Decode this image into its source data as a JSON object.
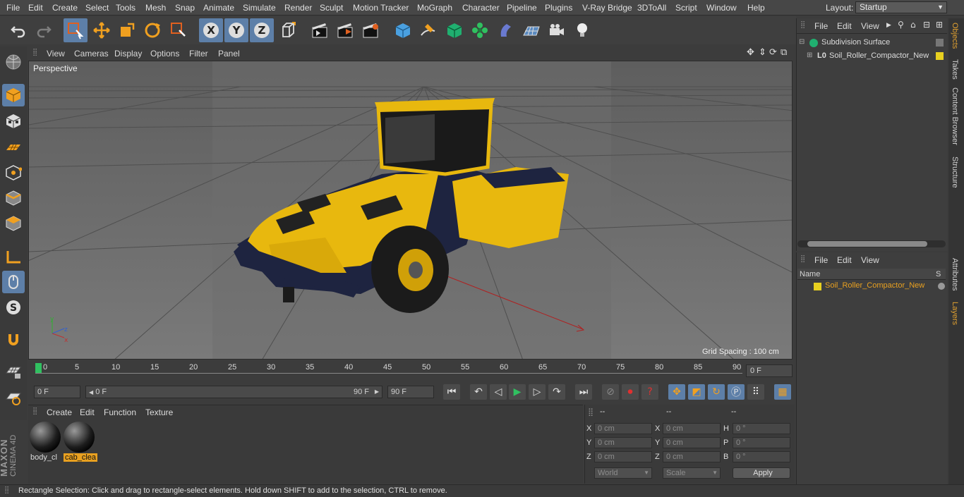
{
  "menubar": {
    "items": [
      "File",
      "Edit",
      "Create",
      "Select",
      "Tools",
      "Mesh",
      "Snap",
      "Animate",
      "Simulate",
      "Render",
      "Sculpt",
      "Motion Tracker",
      "MoGraph",
      "Character",
      "Pipeline",
      "Plugins",
      "V-Ray Bridge",
      "3DToAll",
      "Script",
      "Window",
      "Help"
    ],
    "layout_label": "Layout:",
    "layout_value": "Startup"
  },
  "viewport": {
    "menu": [
      "View",
      "Cameras",
      "Display",
      "Options",
      "Filter",
      "Panel"
    ],
    "label": "Perspective",
    "grid_spacing": "Grid Spacing : 100 cm"
  },
  "timeline": {
    "ticks": [
      "0",
      "5",
      "10",
      "15",
      "20",
      "25",
      "30",
      "35",
      "40",
      "45",
      "50",
      "55",
      "60",
      "65",
      "70",
      "75",
      "80",
      "85",
      "90"
    ],
    "current_frame": "0 F",
    "start_field": "0 F",
    "range_start": "0 F",
    "range_end": "90 F",
    "end_field": "90 F"
  },
  "materials": {
    "menu": [
      "Create",
      "Edit",
      "Function",
      "Texture"
    ],
    "items": [
      {
        "name": "body_cl"
      },
      {
        "name": "cab_clea"
      }
    ]
  },
  "coords": {
    "headers": [
      "--",
      "--",
      "--"
    ],
    "rows": [
      {
        "a": "X",
        "av": "0 cm",
        "b": "X",
        "bv": "0 cm",
        "c": "H",
        "cv": "0 °"
      },
      {
        "a": "Y",
        "av": "0 cm",
        "b": "Y",
        "bv": "0 cm",
        "c": "P",
        "cv": "0 °"
      },
      {
        "a": "Z",
        "av": "0 cm",
        "b": "Z",
        "bv": "0 cm",
        "c": "B",
        "cv": "0 °"
      }
    ],
    "world": "World",
    "scale": "Scale",
    "apply": "Apply"
  },
  "objects": {
    "menu": [
      "File",
      "Edit",
      "View"
    ],
    "items": [
      "Subdivision Surface",
      "Soil_Roller_Compactor_New"
    ]
  },
  "layers": {
    "menu": [
      "File",
      "Edit",
      "View"
    ],
    "col_name": "Name",
    "col_s": "S",
    "item": "Soil_Roller_Compactor_New"
  },
  "right_tabs": [
    "Objects",
    "Takes",
    "Content Browser",
    "Structure",
    "Attributes",
    "Layers"
  ],
  "status": "Rectangle Selection: Click and drag to rectangle-select elements. Hold down SHIFT to add to the selection, CTRL to remove.",
  "brand": {
    "line1": "MAXON",
    "line2": "CINEMA 4D"
  },
  "colors": {
    "accent": "#5d7fa8",
    "object_yellow": "#e8d020",
    "selected_orange": "#e8a020"
  }
}
